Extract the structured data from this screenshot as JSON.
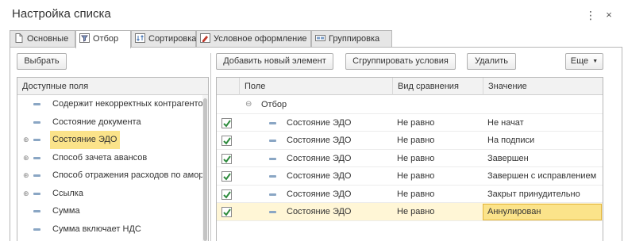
{
  "window": {
    "title": "Настройка списка",
    "more_label": "⋮",
    "close_label": "×"
  },
  "tabs": [
    {
      "label": "Основные",
      "icon": "document-icon"
    },
    {
      "label": "Отбор",
      "icon": "filter-icon",
      "active": true
    },
    {
      "label": "Сортировка",
      "icon": "sort-icon"
    },
    {
      "label": "Условное оформление",
      "icon": "conditional-format-icon"
    },
    {
      "label": "Группировка",
      "icon": "grouping-icon"
    }
  ],
  "left": {
    "select_button": "Выбрать",
    "header": "Доступные поля",
    "items": [
      {
        "label": "Содержит некорректных контрагентов",
        "expandable": false
      },
      {
        "label": "Состояние документа",
        "expandable": false
      },
      {
        "label": "Состояние ЭДО",
        "expandable": true,
        "selected": true
      },
      {
        "label": "Способ зачета авансов",
        "expandable": true
      },
      {
        "label": "Способ отражения расходов по амортизации",
        "expandable": true
      },
      {
        "label": "Ссылка",
        "expandable": true
      },
      {
        "label": "Сумма",
        "expandable": false
      },
      {
        "label": "Сумма включает НДС",
        "expandable": false
      }
    ]
  },
  "toolbar": {
    "add_button": "Добавить новый элемент",
    "group_button": "Сгруппировать условия",
    "delete_button": "Удалить",
    "more_button": "Еще"
  },
  "filter_table": {
    "columns": {
      "field": "Поле",
      "comparison": "Вид сравнения",
      "value": "Значение"
    },
    "group_label": "Отбор",
    "rows": [
      {
        "checked": true,
        "field": "Состояние ЭДО",
        "comparison": "Не равно",
        "value": "Не начат"
      },
      {
        "checked": true,
        "field": "Состояние ЭДО",
        "comparison": "Не равно",
        "value": "На подписи"
      },
      {
        "checked": true,
        "field": "Состояние ЭДО",
        "comparison": "Не равно",
        "value": "Завершен"
      },
      {
        "checked": true,
        "field": "Состояние ЭДО",
        "comparison": "Не равно",
        "value": "Завершен с исправлением"
      },
      {
        "checked": true,
        "field": "Состояние ЭДО",
        "comparison": "Не равно",
        "value": "Закрыт принудительно"
      },
      {
        "checked": true,
        "field": "Состояние ЭДО",
        "comparison": "Не равно",
        "value": "Аннулирован",
        "selected": true
      }
    ]
  },
  "colors": {
    "selection": "#fbe38a",
    "check": "#2e8b3d",
    "accent_icon": "#8aa6c4"
  }
}
